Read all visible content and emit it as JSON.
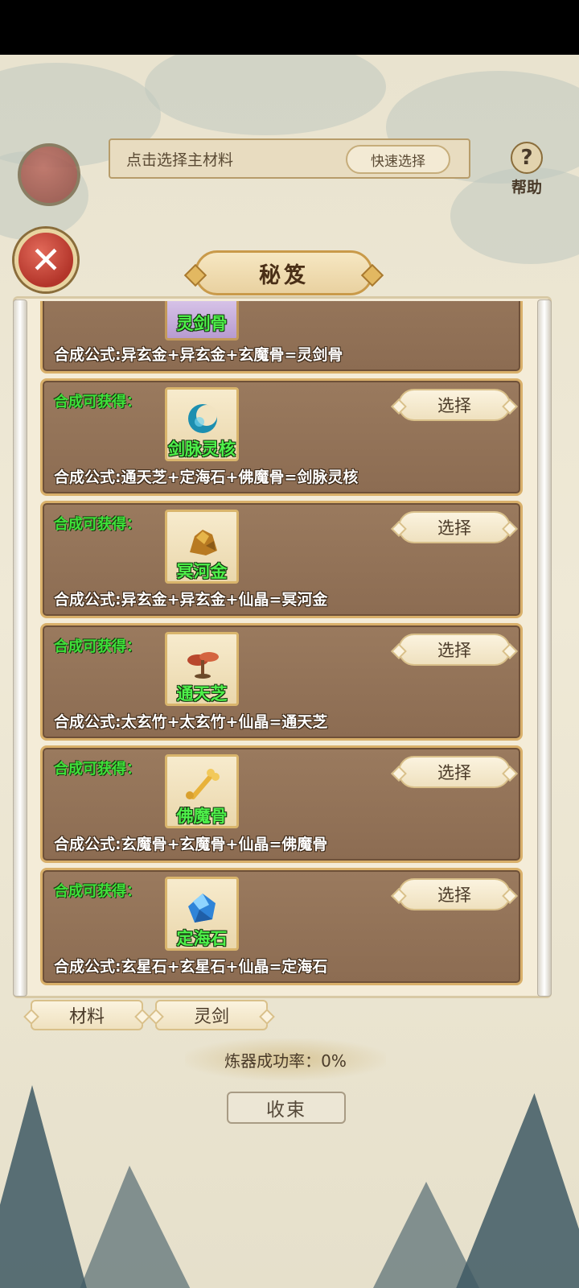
{
  "background": {
    "material_prompt": "点击选择主材料",
    "quick_select": "快速选择",
    "help_label": "帮助",
    "success_rate": "炼器成功率：0%",
    "collapse": "收束"
  },
  "popup": {
    "title": "秘笈",
    "close_icon": "close-icon",
    "obtain_label": "合成可获得：",
    "select_label": "选择",
    "items": [
      {
        "name": "灵剑骨",
        "formula": "合成公式:异玄金+异玄金+玄魔骨=灵剑骨",
        "icon": "bone-sword-icon",
        "partial": true
      },
      {
        "name": "剑脉灵核",
        "formula": "合成公式:通天芝+定海石+佛魔骨=剑脉灵核",
        "icon": "crescent-core-icon"
      },
      {
        "name": "冥河金",
        "formula": "合成公式:异玄金+异玄金+仙晶=冥河金",
        "icon": "gold-ore-icon"
      },
      {
        "name": "通天芝",
        "formula": "合成公式:太玄竹+太玄竹+仙晶=通天芝",
        "icon": "mushroom-icon"
      },
      {
        "name": "佛魔骨",
        "formula": "合成公式:玄魔骨+玄魔骨+仙晶=佛魔骨",
        "icon": "bone-icon"
      },
      {
        "name": "定海石",
        "formula": "合成公式:玄星石+玄星石+仙晶=定海石",
        "icon": "blue-crystal-icon"
      }
    ]
  },
  "tabs": [
    "材料",
    "灵剑"
  ]
}
